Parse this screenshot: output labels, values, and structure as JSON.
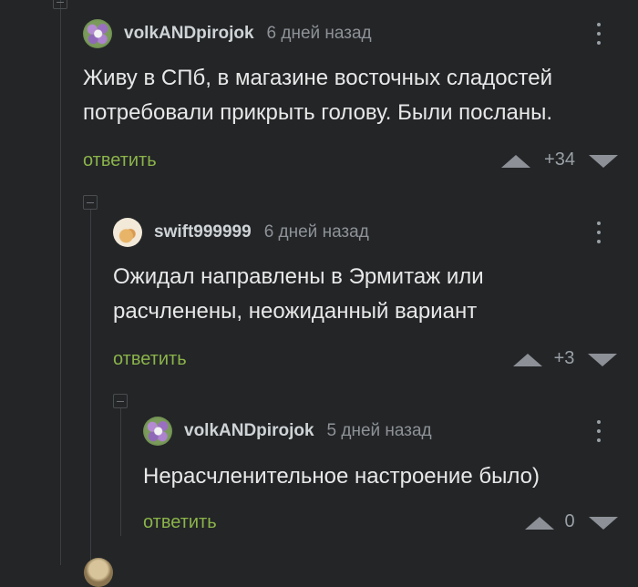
{
  "comments": [
    {
      "author": "volkANDpirojok",
      "date": "6 дней назад",
      "avatar": "flower-avatar",
      "lines": [
        "Живу в СПб, в магазине восточных сладостей",
        "потребовали прикрыть голову. Были посланы."
      ],
      "reply_label": "ответить",
      "rating": "+34"
    },
    {
      "author": "swift999999",
      "date": "6 дней назад",
      "avatar": "cat-avatar",
      "lines": [
        "Ожидал направлены в Эрмитаж или",
        "расчленены, неожиданный вариант"
      ],
      "reply_label": "ответить",
      "rating": "+3"
    },
    {
      "author": "volkANDpirojok",
      "date": "5 дней назад",
      "avatar": "flower-avatar",
      "lines": [
        "Нерасчленительное настроение было)"
      ],
      "reply_label": "ответить",
      "rating": "0"
    }
  ],
  "colors": {
    "background": "#232527",
    "reply_link": "#8bb34a",
    "muted": "#8e9297"
  }
}
